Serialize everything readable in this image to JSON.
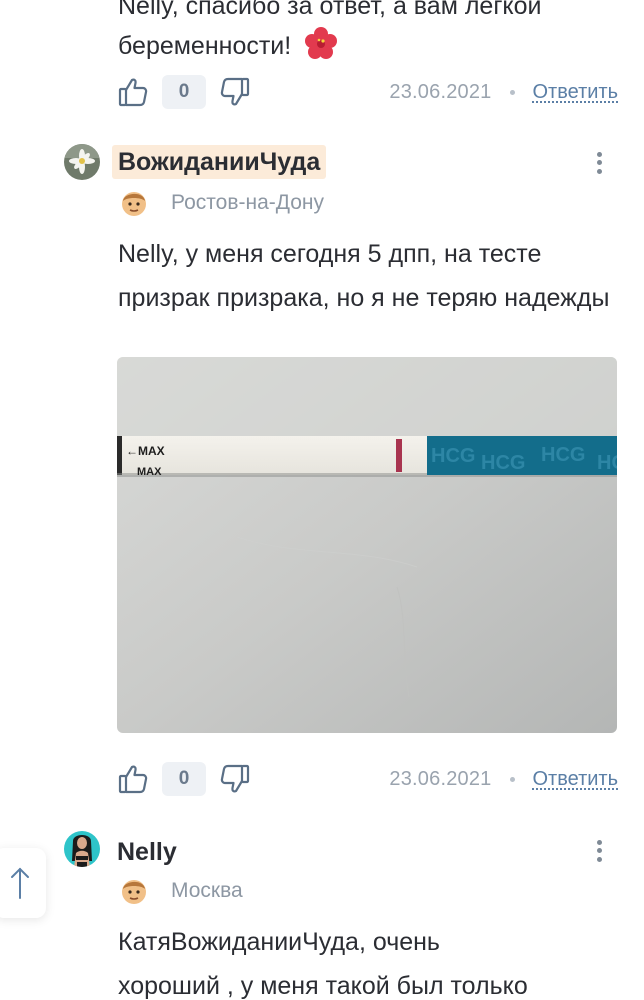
{
  "top_comment": {
    "text_line1": "Nelly, спасибо за ответ, а вам легкой",
    "text_line2": "беременности!",
    "emoji": "hibiscus-flower",
    "likes": "0",
    "date": "23.06.2021",
    "reply_label": "Ответить"
  },
  "comment1": {
    "author": "ВожиданииЧуда",
    "city": "Ростов-на-Дону",
    "mention": "Nelly",
    "text": ", у меня сегодня 5 дпп, на тесте призрак призрака, но я не теряю надежды",
    "photo": {
      "strip_label_top": "←MAX",
      "strip_label_bottom": "MAX",
      "brand_text": "HCG HCG HCG"
    },
    "likes": "0",
    "date": "23.06.2021",
    "reply_label": "Ответить"
  },
  "comment2": {
    "author": "Nelly",
    "city": "Москва",
    "mention": "КатяВожиданииЧуда",
    "text_line1": ", очень",
    "text_line2": "хороший , у меня такой был только"
  },
  "colors": {
    "accent_link": "#5b7fa6",
    "muted": "#9aa3ae",
    "highlight": "#fcebd9",
    "text": "#2b2d33"
  }
}
